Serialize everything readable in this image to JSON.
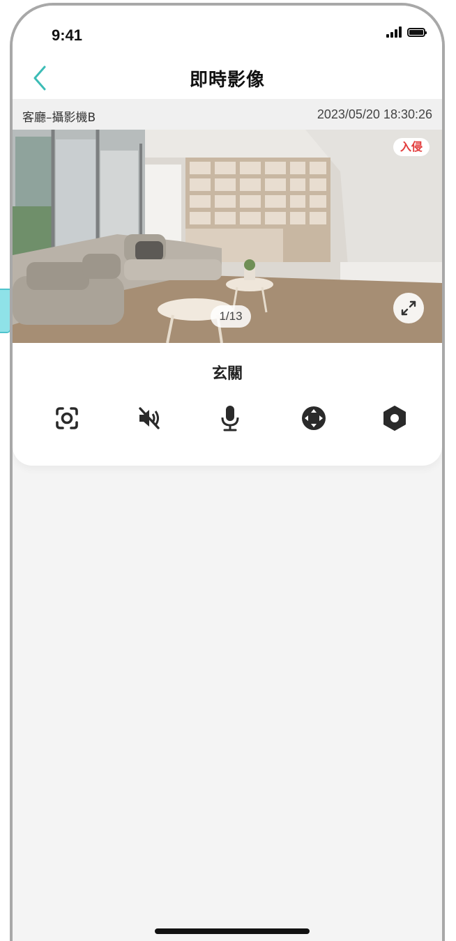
{
  "status_bar": {
    "time": "9:41"
  },
  "header": {
    "title": "即時影像"
  },
  "camera": {
    "name": "客廳–攝影機B",
    "timestamp": "2023/05/20 18:30:26",
    "alert_badge": "入侵",
    "page_counter": "1/13",
    "room_label": "玄關"
  },
  "controls": [
    {
      "icon": "screenshot-icon"
    },
    {
      "icon": "mute-icon"
    },
    {
      "icon": "microphone-icon"
    },
    {
      "icon": "ptz-direction-icon"
    },
    {
      "icon": "settings-hex-icon"
    }
  ],
  "colors": {
    "accent": "#3cbcb6",
    "alert": "#e23b3b",
    "background": "#f4f4f4"
  }
}
